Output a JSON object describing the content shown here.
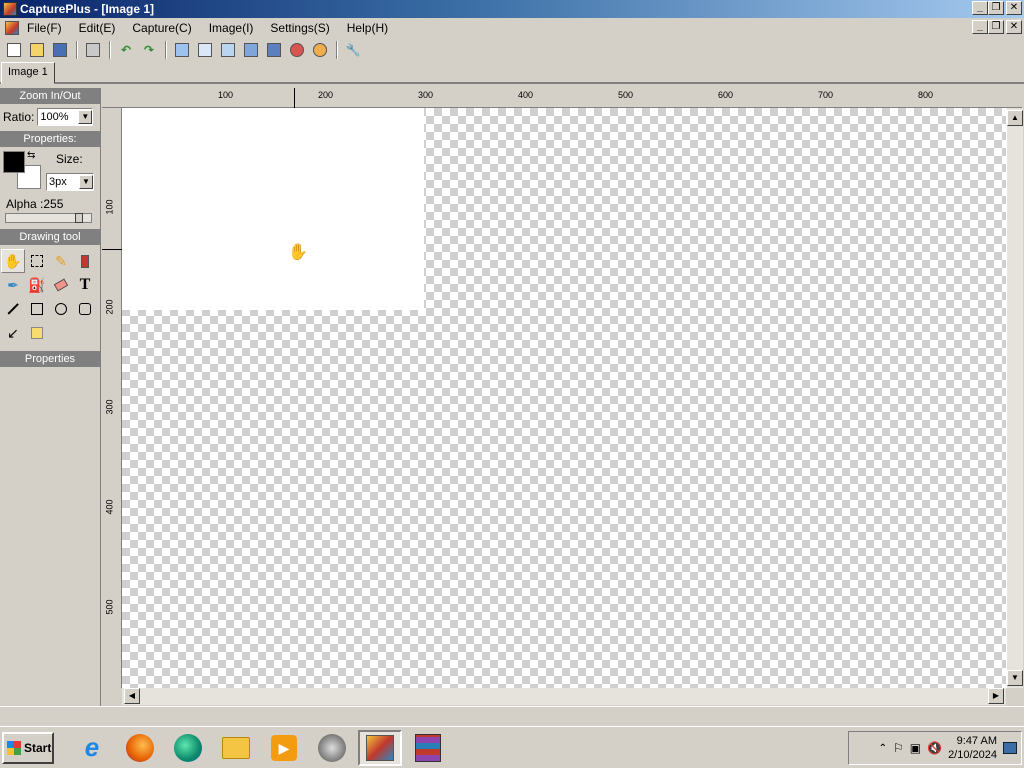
{
  "window": {
    "title": "CapturePlus - [Image 1]"
  },
  "menu": [
    "File(F)",
    "Edit(E)",
    "Capture(C)",
    "Image(I)",
    "Settings(S)",
    "Help(H)"
  ],
  "tabs": [
    {
      "label": "Image 1"
    }
  ],
  "panel": {
    "zoom_header": "Zoom In/Out",
    "ratio_label": "Ratio:",
    "ratio_value": "100%",
    "properties_header": "Properties:",
    "size_label": "Size:",
    "size_value": "3px",
    "alpha_label": "Alpha :255",
    "drawing_tool_header": "Drawing tool",
    "properties_footer": "Properties",
    "foreground_color": "#000000",
    "background_color": "#ffffff"
  },
  "ruler": {
    "top_labels": [
      "100",
      "200",
      "300",
      "400",
      "500",
      "600",
      "700",
      "800"
    ],
    "left_labels": [
      "100",
      "200",
      "300",
      "400",
      "500"
    ]
  },
  "taskbar": {
    "start_label": "Start",
    "time": "9:47 AM",
    "date": "2/10/2024"
  }
}
